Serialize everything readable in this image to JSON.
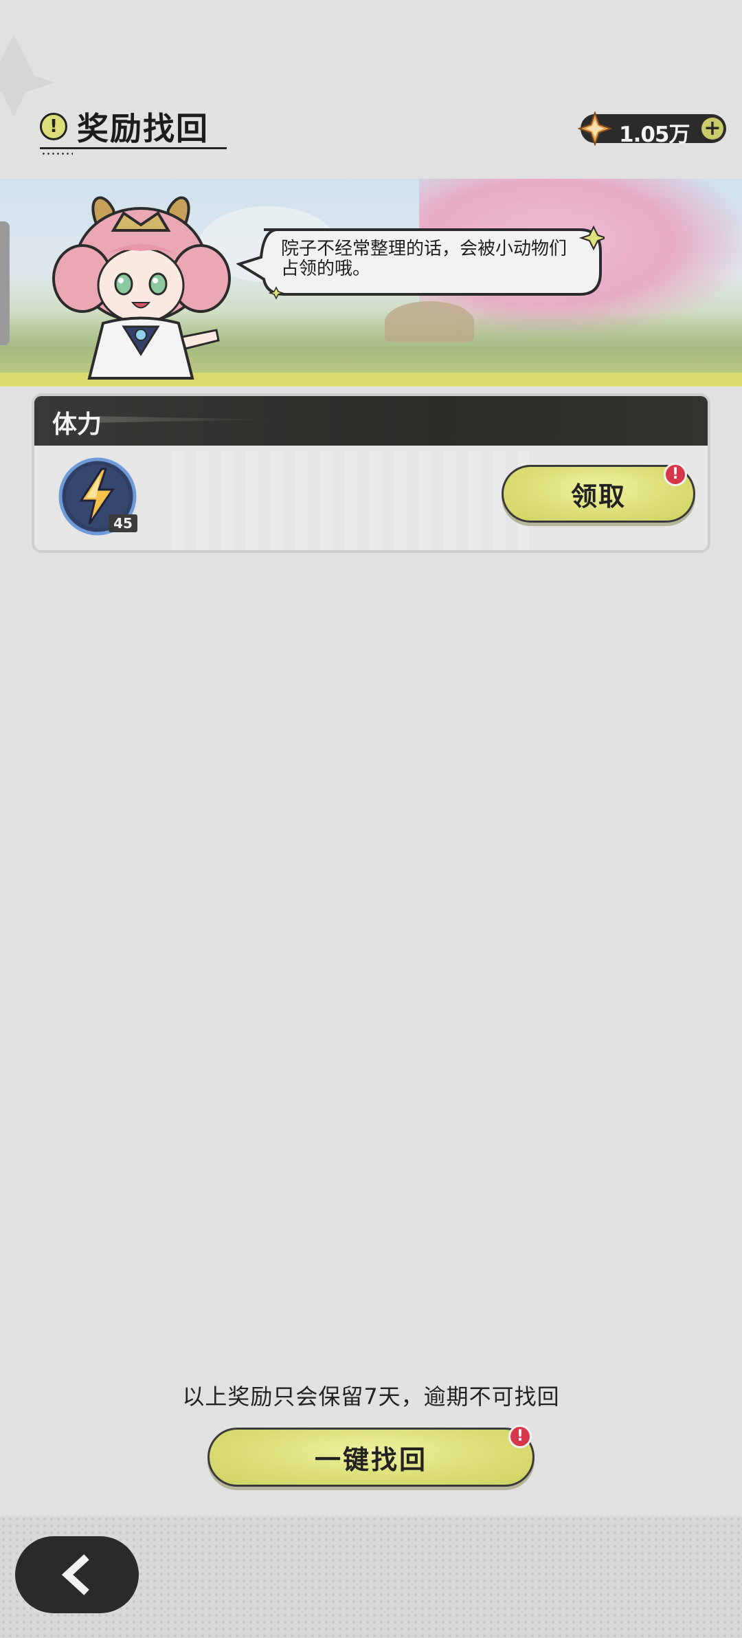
{
  "header": {
    "title": "奖励找回",
    "title_icon": "exclamation-icon",
    "currency": {
      "icon": "crystal-star-icon",
      "value": "1.05万",
      "add_icon": "plus-icon"
    }
  },
  "banner": {
    "character": "pink-haired-chibi-character",
    "speech_text": "院子不经常整理的话，会被小动物们占领的哦。"
  },
  "reward_card": {
    "title": "体力",
    "item": {
      "icon": "lightning-bolt-icon",
      "count": "45"
    },
    "claim_label": "领取",
    "claim_alert_icon": "!"
  },
  "footer": {
    "note": "以上奖励只会保留7天，逾期不可找回",
    "recover_all_label": "一键找回",
    "recover_alert_icon": "!",
    "back_icon": "chevron-left-icon"
  },
  "colors": {
    "background": "#e1e1e1",
    "accent_yellow": "#dadd73",
    "dark": "#2a2a2a",
    "alert_red": "#d6374a"
  }
}
